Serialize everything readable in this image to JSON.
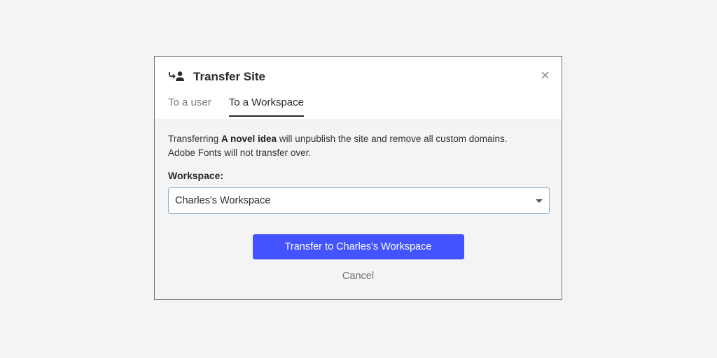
{
  "dialog": {
    "title": "Transfer Site",
    "title_icon": "transfer-user-icon",
    "close_icon": "close-icon",
    "tabs": [
      {
        "label": "To a user",
        "active": false
      },
      {
        "label": "To a Workspace",
        "active": true
      }
    ]
  },
  "body": {
    "desc_prefix": "Transferring ",
    "site_name": "A novel idea",
    "desc_suffix": " will unpublish the site and remove all custom domains.",
    "desc_line2": "Adobe Fonts will not transfer over.",
    "workspace_label": "Workspace:",
    "workspace_selected": "Charles's Workspace"
  },
  "actions": {
    "primary_label": "Transfer to Charles's Workspace",
    "cancel_label": "Cancel"
  },
  "colors": {
    "primary": "#4353ff",
    "select_border": "#8fb2cf"
  }
}
